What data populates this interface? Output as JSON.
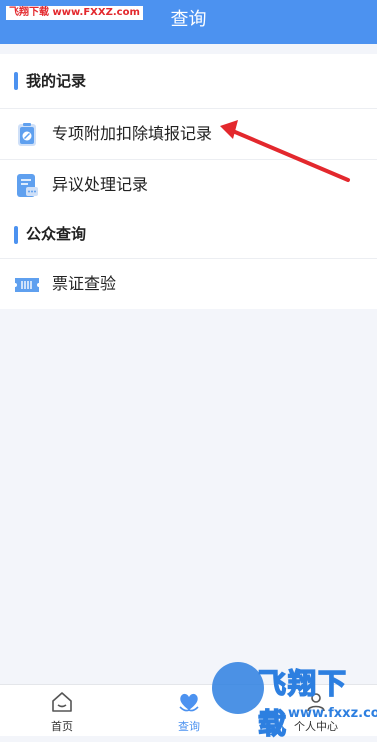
{
  "watermark": "飞翔下载 www.FXXZ.com",
  "header": {
    "title": "查询"
  },
  "my_records": {
    "title": "我的记录",
    "items": [
      {
        "label": "专项附加扣除填报记录",
        "icon": "deduction-record-icon"
      },
      {
        "label": "异议处理记录",
        "icon": "objection-record-icon"
      }
    ]
  },
  "public_query": {
    "title": "公众查询",
    "items": [
      {
        "label": "票证查验",
        "icon": "ticket-verify-icon"
      }
    ]
  },
  "tabbar": {
    "tabs": [
      {
        "label": "首页",
        "icon": "home-icon"
      },
      {
        "label": "查询",
        "icon": "heart-hand-icon"
      },
      {
        "label": "个人中心",
        "icon": "person-icon"
      }
    ]
  },
  "logo": {
    "text": "飞翔下载",
    "url": "www.fxxz.com"
  },
  "colors": {
    "primary": "#4c92f0",
    "annotation_arrow": "#e3282d"
  }
}
